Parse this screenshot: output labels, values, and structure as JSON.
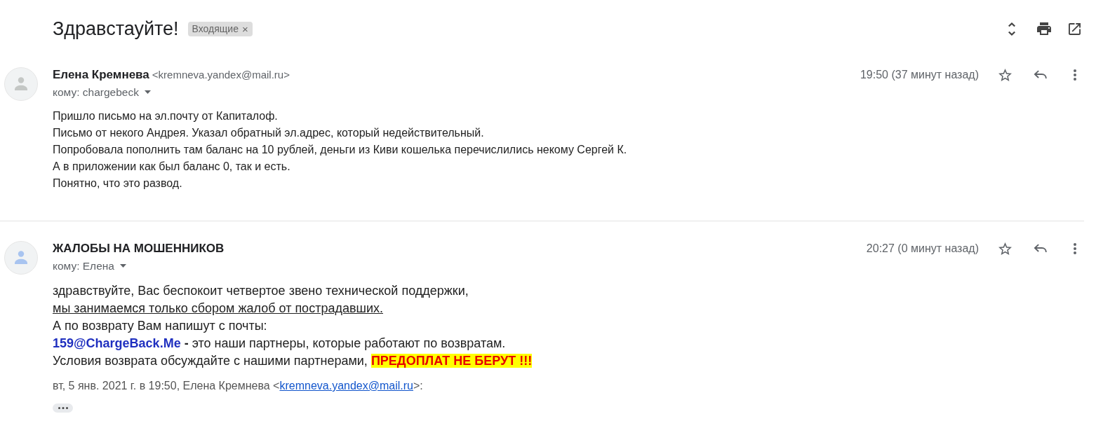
{
  "thread": {
    "subject": "Здравстауйте!",
    "labels": [
      {
        "text": "Входящие",
        "remove": "×"
      }
    ]
  },
  "messages": [
    {
      "kind": "plain",
      "avatar": {
        "color": "#c4c7c5"
      },
      "sender": "Елена Кремнева",
      "sender_email": "<kremneva.yandex@mail.ru>",
      "recipient": "кому: chargebeck",
      "time": "19:50 (37 минут назад)",
      "starred": false,
      "lines": [
        {
          "parts": [
            {
              "kind": "plain",
              "text": "Пришло письмо на эл.почту от Капиталоф."
            }
          ]
        },
        {
          "parts": [
            {
              "kind": "plain",
              "text": "Письмо от некого Андрея. Указал обратный эл.адрес, который недействительный."
            }
          ]
        },
        {
          "parts": [
            {
              "kind": "plain",
              "text": "Попробовала пополнить там баланс на 10 рублей, деньги из Киви кошелька перечислились некому Сергей К."
            }
          ]
        },
        {
          "parts": [
            {
              "kind": "plain",
              "text": "А в приложении как был баланс 0, так и есть."
            }
          ]
        },
        {
          "parts": [
            {
              "kind": "plain",
              "text": "Понятно, что это развод."
            }
          ]
        }
      ]
    },
    {
      "kind": "formatted",
      "avatar": {
        "color": "#a8c4f0"
      },
      "sender": "ЖАЛОБЫ НА МОШЕННИКОВ",
      "recipient": "кому: Елена",
      "time": "20:27 (0 минут назад)",
      "starred": false,
      "lines": [
        {
          "parts": [
            {
              "kind": "plain",
              "text": "здравствуйте, Вас беспокоит четвертое звено технической поддержки,"
            }
          ]
        },
        {
          "parts": [
            {
              "kind": "underlined",
              "text": "мы занимаемся только сбором жалоб от пострадавших."
            }
          ]
        },
        {
          "parts": [
            {
              "kind": "plain",
              "text": "А по возврату Вам напишут с почты:"
            }
          ]
        },
        {
          "parts": [
            {
              "kind": "email",
              "text": "159@ChargeBack.Me"
            },
            {
              "kind": "bold",
              "text": "-"
            },
            {
              "kind": "plain",
              "text": "это наши партнеры, которые работают по возвратам."
            }
          ]
        },
        {
          "parts": [
            {
              "kind": "plain",
              "text": "Условия возврата обсуждайте с нашими партнерами,"
            },
            {
              "kind": "alert",
              "text": "ПРЕДОПЛАТ НЕ БЕРУТ !!!"
            }
          ]
        }
      ],
      "quote": {
        "prefix": "вт, 5 янв. 2021 г. в 19:50, Елена Кремнева <",
        "link": "kremneva.yandex@mail.ru",
        "suffix": ">:"
      }
    }
  ]
}
